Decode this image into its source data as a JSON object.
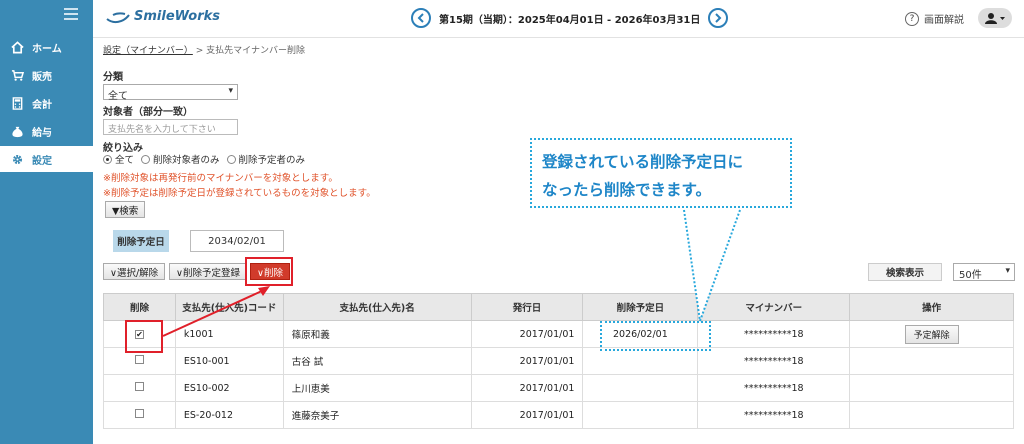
{
  "sidebar": {
    "items": [
      {
        "label": "ホーム",
        "icon": "home-icon"
      },
      {
        "label": "販売",
        "icon": "cart-icon"
      },
      {
        "label": "会計",
        "icon": "calculator-icon"
      },
      {
        "label": "給与",
        "icon": "money-bag-icon"
      },
      {
        "label": "設定",
        "icon": "gear-icon"
      }
    ],
    "active_index": 4
  },
  "header": {
    "logo_text": "SmileWorks",
    "period": "第15期（当期）：2025年04月01日 - 2026年03月31日",
    "help_label": "画面解説"
  },
  "breadcrumb": {
    "parent": "設定（マイナンバー）",
    "separator": ">",
    "current": "支払先マイナンバー削除"
  },
  "filters": {
    "category_label": "分類",
    "category_value": "全て",
    "target_label": "対象者（部分一致）",
    "target_placeholder": "支払先名を入力して下さい",
    "narrow_label": "絞り込み",
    "radios": [
      "全て",
      "削除対象者のみ",
      "削除予定者のみ"
    ],
    "notes": [
      "※削除対象は再発行前のマイナンバーを対象とします。",
      "※削除予定は削除予定日が登録されているものを対象とします。"
    ],
    "search_button": "▼検索"
  },
  "schedule": {
    "label": "削除予定日",
    "value": "2034/02/01"
  },
  "actions": {
    "select_toggle": "∨選択/解除",
    "register_schedule": "∨削除予定登録",
    "delete": "∨削除"
  },
  "display": {
    "label": "検索表示",
    "value": "50件"
  },
  "table": {
    "headers": [
      "削除",
      "支払先(仕入先)コード",
      "支払先(仕入先)名",
      "発行日",
      "削除予定日",
      "マイナンバー",
      "操作"
    ],
    "rows": [
      {
        "checked": true,
        "code": "k1001",
        "name": "篠原和義",
        "issued": "2017/01/01",
        "scheduled": "2026/02/01",
        "mynumber": "**********18",
        "action": "予定解除"
      },
      {
        "checked": false,
        "code": "ES10-001",
        "name": "古谷 試",
        "issued": "2017/01/01",
        "scheduled": "",
        "mynumber": "**********18",
        "action": ""
      },
      {
        "checked": false,
        "code": "ES10-002",
        "name": "上川恵美",
        "issued": "2017/01/01",
        "scheduled": "",
        "mynumber": "**********18",
        "action": ""
      },
      {
        "checked": false,
        "code": "ES-20-012",
        "name": "進藤奈美子",
        "issued": "2017/01/01",
        "scheduled": "",
        "mynumber": "**********18",
        "action": ""
      }
    ]
  },
  "callout": {
    "line1": "登録されている削除予定日に",
    "line2": "なったら削除できます。"
  },
  "colors": {
    "sidebar": "#3a8ab5",
    "accent": "#28a8dc",
    "danger": "#d13b2b"
  }
}
